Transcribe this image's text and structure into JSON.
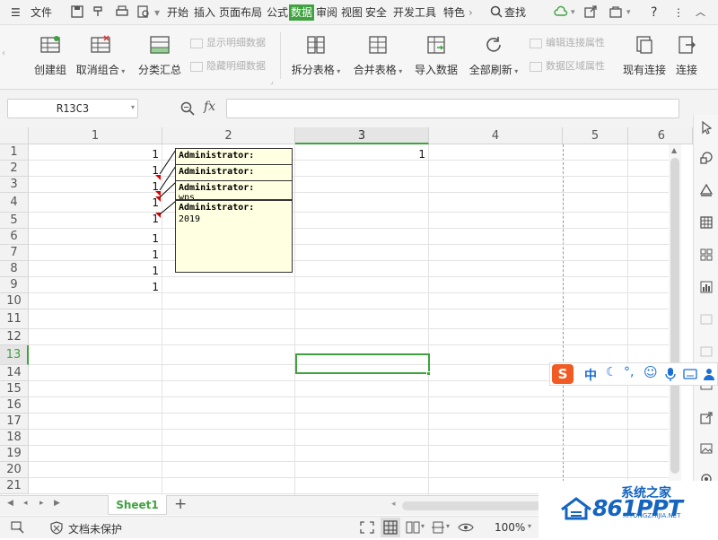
{
  "menu": {
    "file_label": "文件",
    "tabs": [
      "开始",
      "插入",
      "页面布局",
      "公式",
      "数据",
      "审阅",
      "视图",
      "安全",
      "开发工具",
      "特色"
    ],
    "active_tab": "数据",
    "search_label": "查找"
  },
  "ribbon": {
    "create_group": "创建组",
    "ungroup": "取消组合",
    "subtotal": "分类汇总",
    "show_detail": "显示明细数据",
    "hide_detail": "隐藏明细数据",
    "split_table": "拆分表格",
    "merge_table": "合并表格",
    "import_data": "导入数据",
    "refresh_all": "全部刷新",
    "edit_conn": "编辑连接属性",
    "data_range": "数据区域属性",
    "existing_conn": "现有连接",
    "connect": "连接"
  },
  "formula_bar": {
    "name_box": "R13C3",
    "fx_label": "fx",
    "content": ""
  },
  "columns": [
    "1",
    "2",
    "3",
    "4",
    "5",
    "6"
  ],
  "selected_column": "3",
  "rows": [
    "1",
    "2",
    "3",
    "4",
    "5",
    "6",
    "7",
    "8",
    "9",
    "10",
    "11",
    "12",
    "13",
    "14",
    "15",
    "16",
    "17",
    "18",
    "19",
    "20",
    "21"
  ],
  "selected_row": "13",
  "col1_values": [
    "1",
    "1",
    "1",
    "1",
    "1",
    "1",
    "1",
    "1",
    "1"
  ],
  "col3_value": "1",
  "comments": [
    {
      "author": "Administrator:",
      "text": ""
    },
    {
      "author": "Administrator:",
      "text": ""
    },
    {
      "author": "Administrator:",
      "text": "wps"
    },
    {
      "author": "Administrator:",
      "text": "2019"
    }
  ],
  "sheet_tab": "Sheet1",
  "add_sheet": "+",
  "status": {
    "protect_label": "文档未保护",
    "zoom": "100%"
  },
  "ime": {
    "lang": "中"
  },
  "watermark": {
    "brand": "861PPT",
    "site": "系统之家",
    "url": "XITONGZHIJIA.NET"
  },
  "colors": {
    "accent": "#3fa23f",
    "comment_bg": "#ffffe1",
    "ime_logo": "#f15a22"
  }
}
